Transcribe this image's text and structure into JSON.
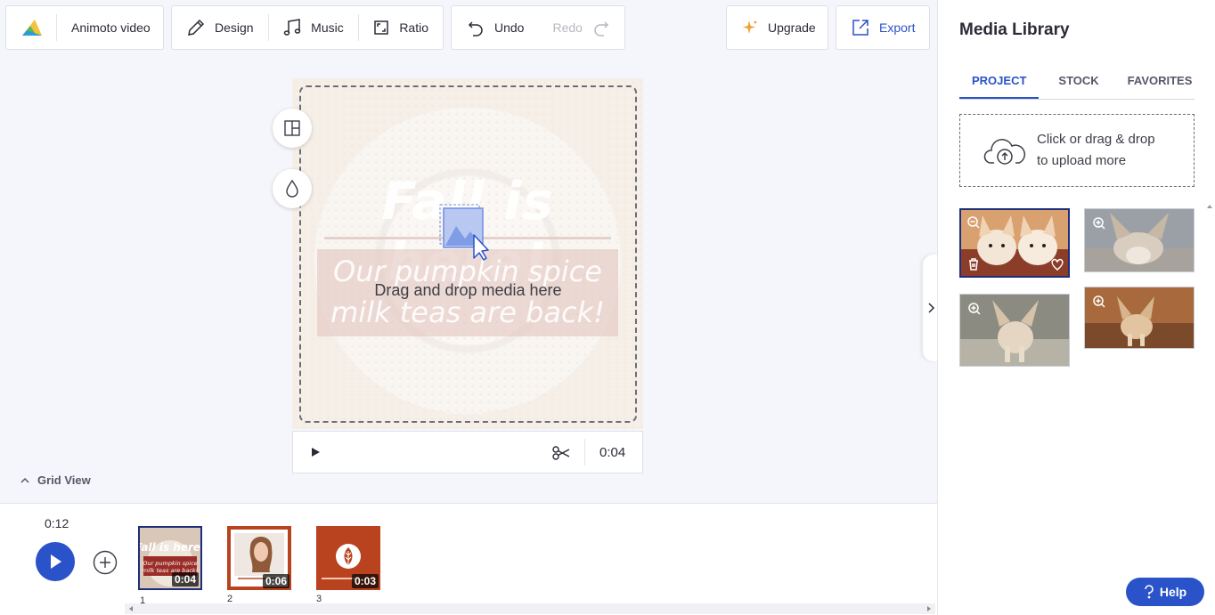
{
  "app": {
    "name": "Animoto video",
    "logo_icon": "animoto-logo-icon"
  },
  "toolbar": {
    "design_label": "Design",
    "music_label": "Music",
    "ratio_label": "Ratio",
    "undo_label": "Undo",
    "redo_label": "Redo",
    "upgrade_label": "Upgrade",
    "export_label": "Export"
  },
  "stage": {
    "title_text": "Fall is here!",
    "subtitle_text": "Our pumpkin spice milk teas are back!",
    "drop_prompt": "Drag and drop media here",
    "layout_tool_icon": "layout-icon",
    "color_tool_icon": "droplet-icon"
  },
  "player": {
    "time": "0:04",
    "play_icon": "play-icon",
    "trim_icon": "scissors-icon"
  },
  "grid_view": {
    "label": "Grid View"
  },
  "timeline": {
    "total_duration": "0:12",
    "clips": [
      {
        "number": "1",
        "duration": "0:04",
        "selected": true
      },
      {
        "number": "2",
        "duration": "0:06",
        "selected": false
      },
      {
        "number": "3",
        "duration": "0:03",
        "selected": false
      }
    ]
  },
  "media_library": {
    "title": "Media Library",
    "tabs": [
      {
        "label": "PROJECT",
        "active": true
      },
      {
        "label": "STOCK",
        "active": false
      },
      {
        "label": "FAVORITES",
        "active": false
      }
    ],
    "upload_line1": "Click or drag & drop",
    "upload_line2": "to upload more"
  },
  "help": {
    "label": "Help"
  },
  "colors": {
    "accent": "#2a52c9",
    "selected_border": "#1d2e7a",
    "clip_red": "#b8431e",
    "upgrade_star": "#f0a030"
  }
}
